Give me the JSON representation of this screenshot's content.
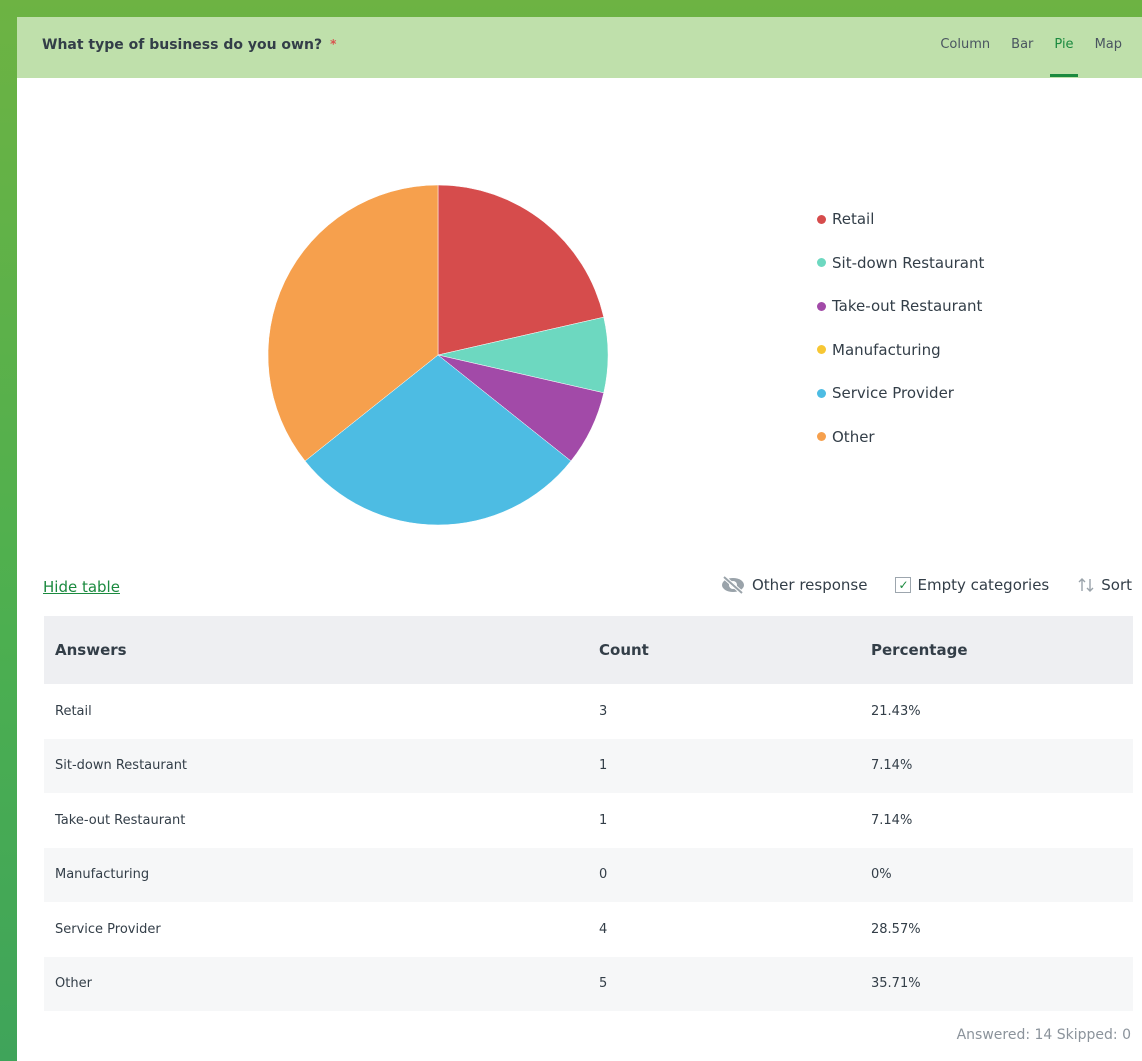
{
  "question": {
    "title": "What type of business do you own?",
    "required_mark": "*"
  },
  "tabs": [
    {
      "label": "Column",
      "active": false
    },
    {
      "label": "Bar",
      "active": false
    },
    {
      "label": "Pie",
      "active": true
    },
    {
      "label": "Map",
      "active": false
    }
  ],
  "chart_data": {
    "type": "pie",
    "title": "",
    "categories": [
      "Retail",
      "Sit-down Restaurant",
      "Take-out Restaurant",
      "Manufacturing",
      "Service Provider",
      "Other"
    ],
    "values": [
      3,
      1,
      1,
      0,
      4,
      5
    ],
    "colors": [
      "#d64c4c",
      "#6dd8c0",
      "#a24aa8",
      "#f7c734",
      "#4dbce3",
      "#f6a04d"
    ],
    "legend_position": "right"
  },
  "table_controls": {
    "hide_table": "Hide table",
    "other_response": "Other response",
    "empty_categories": "Empty categories",
    "sort": "Sort"
  },
  "table": {
    "headers": [
      "Answers",
      "Count",
      "Percentage"
    ],
    "rows": [
      [
        "Retail",
        "3",
        "21.43%"
      ],
      [
        "Sit-down Restaurant",
        "1",
        "7.14%"
      ],
      [
        "Take-out Restaurant",
        "1",
        "7.14%"
      ],
      [
        "Manufacturing",
        "0",
        "0%"
      ],
      [
        "Service Provider",
        "4",
        "28.57%"
      ],
      [
        "Other",
        "5",
        "35.71%"
      ]
    ]
  },
  "summary": "Answered: 14  Skipped: 0"
}
